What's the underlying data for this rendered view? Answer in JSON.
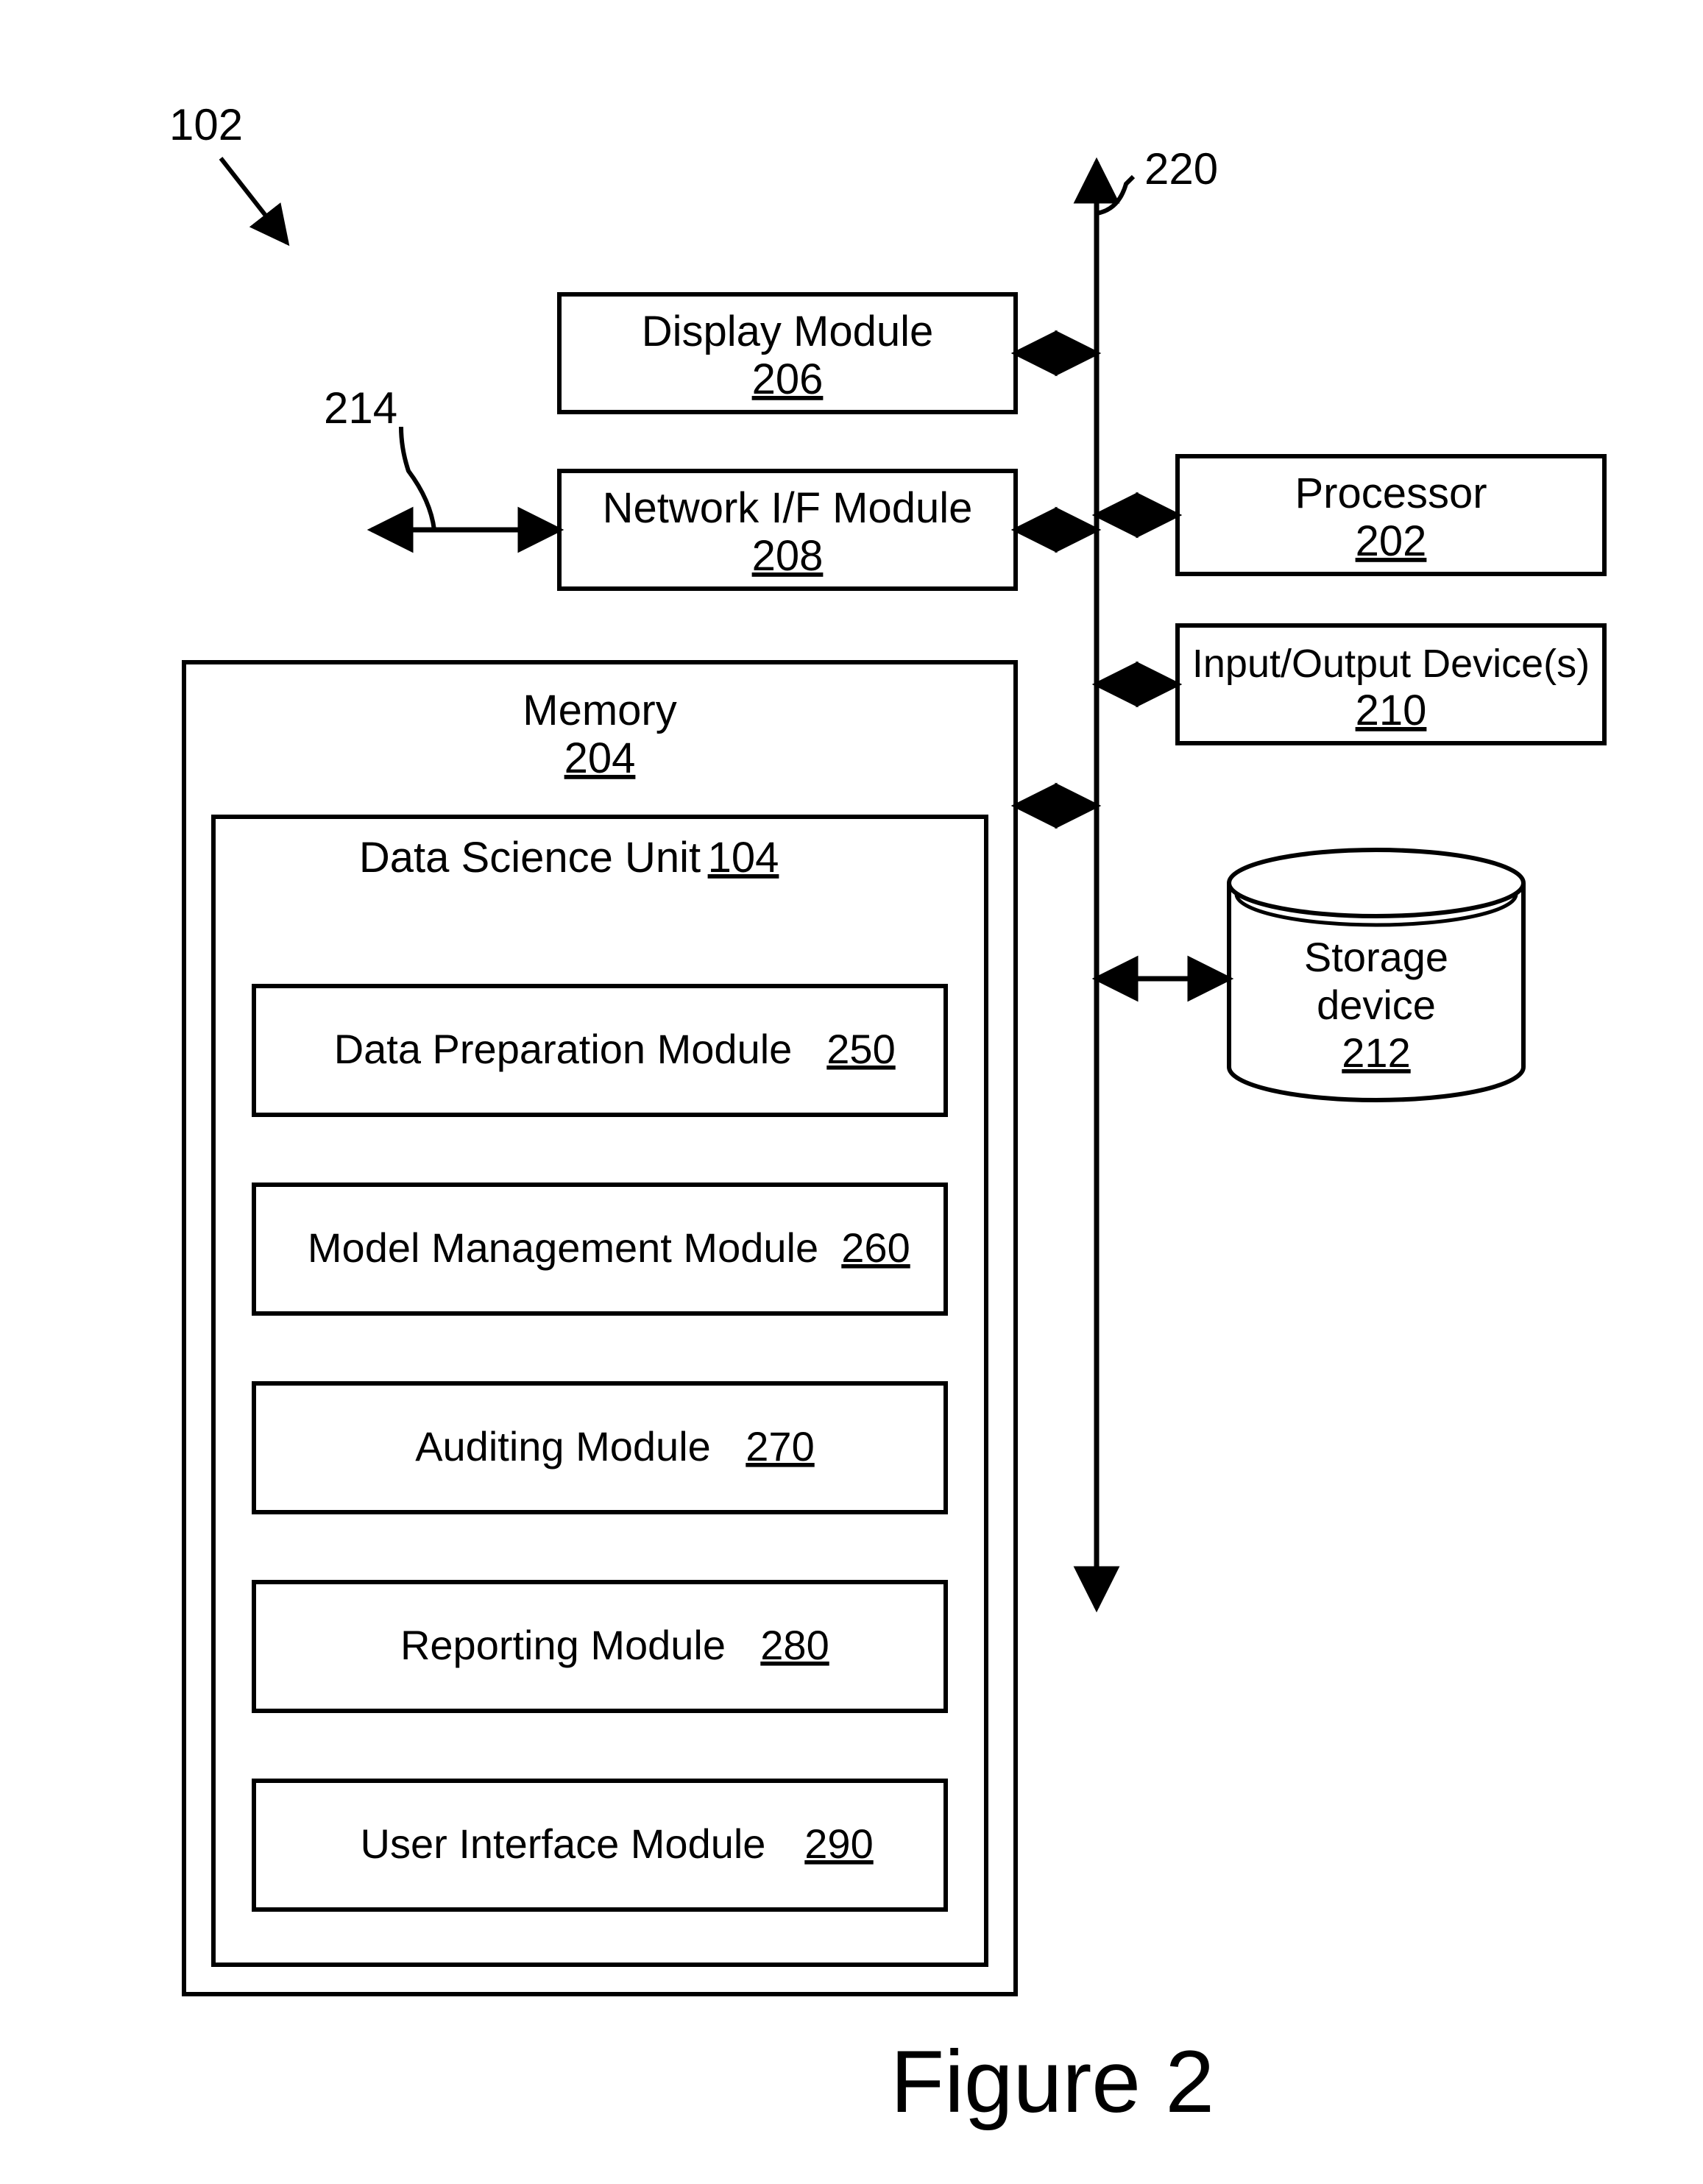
{
  "figure_label": "Figure 2",
  "outer_ref": "102",
  "bus_ref": "220",
  "ext_ref": "214",
  "display": {
    "name": "Display Module",
    "ref": "206"
  },
  "network": {
    "name": "Network I/F Module",
    "ref": "208"
  },
  "memory": {
    "name": "Memory",
    "ref": "204"
  },
  "dsu": {
    "name": "Data Science Unit",
    "ref": "104"
  },
  "mod_250": {
    "name": "Data Preparation Module",
    "ref": "250"
  },
  "mod_260": {
    "name": "Model Management Module",
    "ref": "260"
  },
  "mod_270": {
    "name": "Auditing Module",
    "ref": "270"
  },
  "mod_280": {
    "name": "Reporting Module",
    "ref": "280"
  },
  "mod_290": {
    "name": "User Interface Module",
    "ref": "290"
  },
  "processor": {
    "name": "Processor",
    "ref": "202"
  },
  "io": {
    "name": "Input/Output Device(s)",
    "ref": "210"
  },
  "storage": {
    "name1": "Storage",
    "name2": "device",
    "ref": "212"
  }
}
